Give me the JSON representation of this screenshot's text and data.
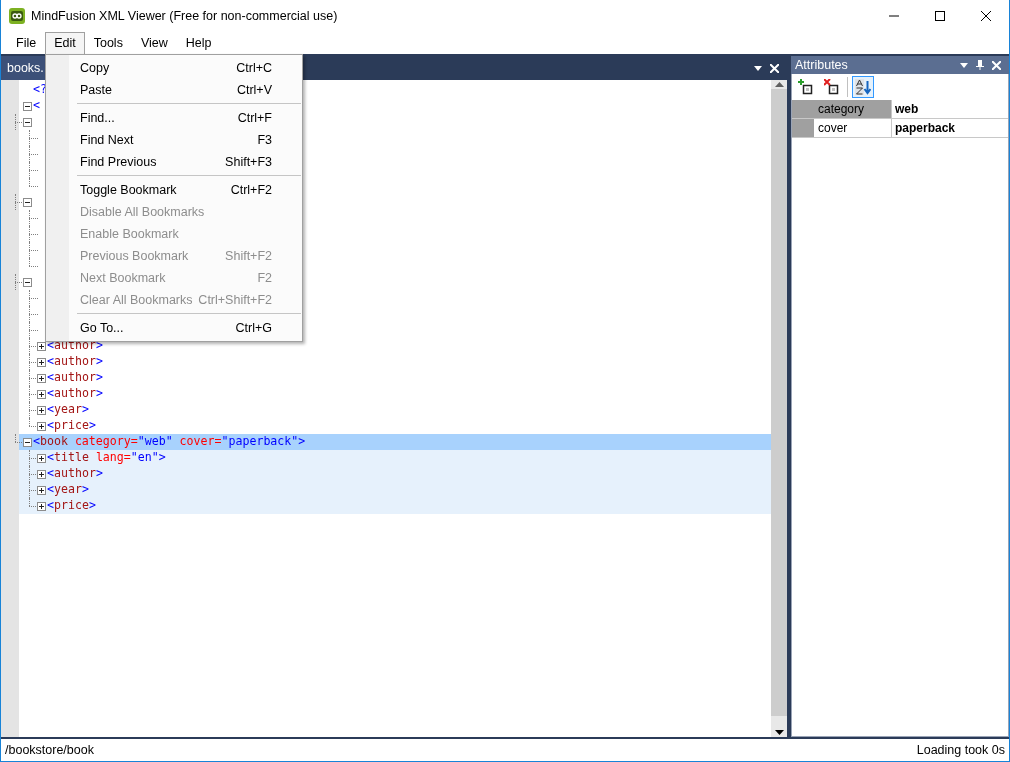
{
  "window": {
    "title": "MindFusion XML Viewer (Free for non-commercial use)"
  },
  "menu_bar": [
    {
      "label": "File",
      "selected": false
    },
    {
      "label": "Edit",
      "selected": true
    },
    {
      "label": "Tools",
      "selected": false
    },
    {
      "label": "View",
      "selected": false
    },
    {
      "label": "Help",
      "selected": false
    }
  ],
  "edit_menu": [
    {
      "kind": "item",
      "label": "Copy",
      "shortcut": "Ctrl+C",
      "disabled": false
    },
    {
      "kind": "item",
      "label": "Paste",
      "shortcut": "Ctrl+V",
      "disabled": false
    },
    {
      "kind": "separator"
    },
    {
      "kind": "item",
      "label": "Find...",
      "shortcut": "Ctrl+F",
      "disabled": false
    },
    {
      "kind": "item",
      "label": "Find Next",
      "shortcut": "F3",
      "disabled": false
    },
    {
      "kind": "item",
      "label": "Find Previous",
      "shortcut": "Shift+F3",
      "disabled": false
    },
    {
      "kind": "separator"
    },
    {
      "kind": "item",
      "label": "Toggle Bookmark",
      "shortcut": "Ctrl+F2",
      "disabled": false
    },
    {
      "kind": "item",
      "label": "Disable All Bookmarks",
      "disabled": true
    },
    {
      "kind": "item",
      "label": "Enable Bookmark",
      "disabled": true
    },
    {
      "kind": "item",
      "label": "Previous Bookmark",
      "shortcut": "Shift+F2",
      "disabled": true
    },
    {
      "kind": "item",
      "label": "Next Bookmark",
      "shortcut": "F2",
      "disabled": true
    },
    {
      "kind": "item",
      "label": "Clear All Bookmarks",
      "shortcut": "Ctrl+Shift+F2",
      "disabled": true
    },
    {
      "kind": "separator"
    },
    {
      "kind": "item",
      "label": "Go To...",
      "shortcut": "Ctrl+G",
      "disabled": false
    }
  ],
  "document": {
    "tab_label": "books.",
    "tree": [
      {
        "kind": "element",
        "text": "<?",
        "selected": false
      },
      {
        "kind": "element",
        "text": "<",
        "expanded": true,
        "selected": false,
        "children": [
          {
            "kind": "element",
            "expanded": true,
            "children": [
              {
                "kind": "covered"
              },
              {
                "kind": "covered"
              },
              {
                "kind": "covered"
              },
              {
                "kind": "covered"
              }
            ]
          },
          {
            "kind": "element",
            "expanded": true,
            "children": [
              {
                "kind": "covered"
              },
              {
                "kind": "covered"
              },
              {
                "kind": "covered"
              },
              {
                "kind": "covered"
              }
            ]
          },
          {
            "kind": "element",
            "expanded": true,
            "children": [
              {
                "kind": "covered"
              },
              {
                "kind": "covered"
              },
              {
                "kind": "covered"
              },
              {
                "kind": "element",
                "text": "<author>",
                "expanded": false,
                "selected": false
              },
              {
                "kind": "element",
                "text": "<author>",
                "expanded": false,
                "selected": false
              },
              {
                "kind": "element",
                "text": "<author>",
                "expanded": false,
                "selected": false
              },
              {
                "kind": "element",
                "text": "<author>",
                "expanded": false,
                "selected": false
              },
              {
                "kind": "element",
                "text": "<year>",
                "expanded": false,
                "selected": false
              },
              {
                "kind": "element",
                "text": "<price>",
                "expanded": false,
                "selected": false
              }
            ]
          },
          {
            "kind": "element",
            "text": "<book category=\"web\" cover=\"paperback\">",
            "expanded": true,
            "selected": true,
            "children": [
              {
                "kind": "element",
                "text": "<title lang=\"en\">",
                "expanded": false,
                "selected": false
              },
              {
                "kind": "element",
                "text": "<author>",
                "expanded": false,
                "selected": false
              },
              {
                "kind": "element",
                "text": "<year>",
                "expanded": false,
                "selected": false
              },
              {
                "kind": "element",
                "text": "<price>",
                "expanded": false,
                "selected": false
              }
            ]
          }
        ]
      }
    ]
  },
  "attributes_panel": {
    "title": "Attributes",
    "sort_pressed": true,
    "rows": [
      {
        "name": "category",
        "value": "web",
        "selected": true
      },
      {
        "name": "cover",
        "value": "paperback",
        "selected": false
      }
    ]
  },
  "status_bar": {
    "path": "/bookstore/book",
    "message": "Loading took 0s"
  }
}
